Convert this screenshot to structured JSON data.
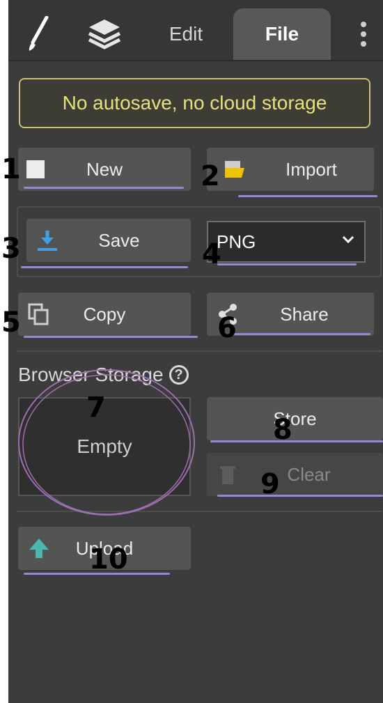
{
  "tabs": [
    {
      "name": "brush",
      "icon": "brush-icon"
    },
    {
      "name": "layers",
      "icon": "layers-icon"
    },
    {
      "label": "Edit"
    },
    {
      "label": "File",
      "active": true
    }
  ],
  "banner": "No autosave, no cloud storage",
  "buttons": {
    "new": "New",
    "import": "Import",
    "save": "Save",
    "copy": "Copy",
    "share": "Share",
    "store": "Store",
    "clear": "Clear",
    "upload": "Upload"
  },
  "format_select": {
    "value": "PNG"
  },
  "browser_storage": {
    "label": "Browser Storage",
    "help": "?",
    "status": "Empty"
  },
  "annotations": [
    "1",
    "2",
    "3",
    "4",
    "5",
    "6",
    "7",
    "8",
    "9",
    "10"
  ],
  "colors": {
    "panel": "#3c3c3c",
    "button": "#545454",
    "banner_text": "#e6e07e",
    "accent_blue": "#3fa0e6",
    "accent_teal": "#4cb6b0",
    "markup": "#9a86d8"
  }
}
